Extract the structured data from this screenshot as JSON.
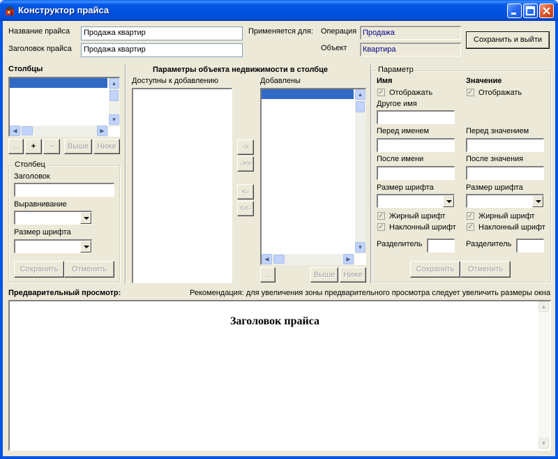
{
  "window": {
    "title": "Конструктор прайса"
  },
  "header": {
    "price_name_label": "Название прайса",
    "price_name_value": "Продажа квартир",
    "price_header_label": "Заголовок прайса",
    "price_header_value": "Продажа квартир",
    "applies_label": "Применяется для:",
    "operation_label": "Операция",
    "operation_value": "Продажа",
    "object_label": "Объект",
    "object_value": "Квартира",
    "save_exit_label": "Сохранить и выйти"
  },
  "columns": {
    "title": "Столбцы",
    "dots_label": "...",
    "add_label": "+",
    "remove_label": "−",
    "up_label": "Выше",
    "down_label": "Ниже"
  },
  "column_group": {
    "title": "Столбец",
    "header_label": "Заголовок",
    "header_value": "",
    "align_label": "Выравнивание",
    "align_value": "",
    "font_size_label": "Размер шрифта",
    "font_size_value": "",
    "save_label": "Сохранить",
    "cancel_label": "Отменить"
  },
  "params": {
    "title": "Параметры объекта недвижимости в столбце",
    "available_label": "Доступны к добавлению",
    "added_label": "Добавлены",
    "move_right": "->",
    "move_all_right": "->>",
    "move_left": "<-",
    "move_all_left": "<<-",
    "dots_label": "...",
    "up_label": "Выше",
    "down_label": "Ниже"
  },
  "parameter": {
    "title": "Параметр",
    "name_title": "Имя",
    "value_title": "Значение",
    "show_label": "Отображать",
    "other_name_label": "Другое имя",
    "before_name_label": "Перед именем",
    "after_name_label": "После имени",
    "before_value_label": "Перед значением",
    "after_value_label": "После значения",
    "font_size_label": "Размер шрифта",
    "bold_label": "Жирный шрифт",
    "italic_label": "Наклонный шрифт",
    "separator_label": "Разделитель",
    "save_label": "Сохранить",
    "cancel_label": "Отменить"
  },
  "preview": {
    "title": "Предварительный просмотр:",
    "hint": "Рекомендация: для увеличения зоны предварительного просмотра следует увеличить размеры окна",
    "content_title": "Заголовок прайса"
  }
}
